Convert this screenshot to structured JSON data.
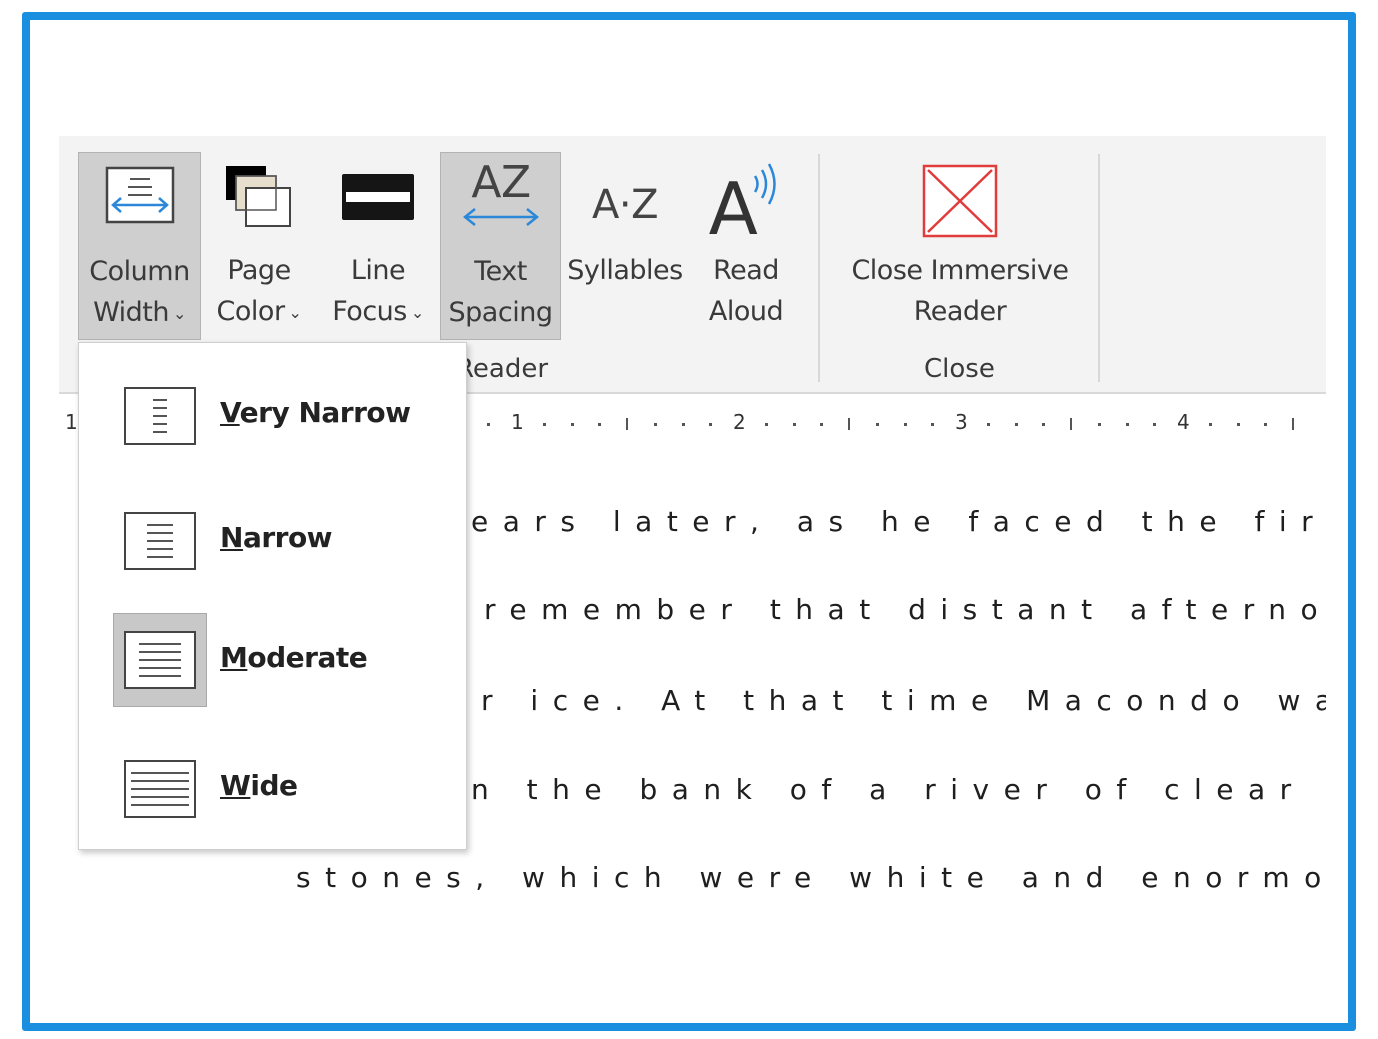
{
  "ribbon": {
    "buttons": [
      {
        "id": "column-width",
        "line1": "Column",
        "line2": "Width",
        "dropdown": true,
        "selected": true,
        "icon": "column-width-icon"
      },
      {
        "id": "page-color",
        "line1": "Page",
        "line2": "Color",
        "dropdown": true,
        "selected": false,
        "icon": "page-color-icon"
      },
      {
        "id": "line-focus",
        "line1": "Line",
        "line2": "Focus",
        "dropdown": true,
        "selected": false,
        "icon": "line-focus-icon"
      },
      {
        "id": "text-spacing",
        "line1": "Text",
        "line2": "Spacing",
        "dropdown": false,
        "selected": true,
        "icon": "text-spacing-icon",
        "icon_text": "AZ"
      },
      {
        "id": "syllables",
        "line1": "Syllables",
        "line2": "",
        "dropdown": false,
        "selected": false,
        "icon": "syllables-icon",
        "icon_text": "A·Z"
      },
      {
        "id": "read-aloud",
        "line1": "Read",
        "line2": "Aloud",
        "dropdown": false,
        "selected": false,
        "icon": "read-aloud-icon",
        "icon_text": "A"
      },
      {
        "id": "close-immersive-reader",
        "line1": "Close Immersive",
        "line2": "Reader",
        "dropdown": false,
        "selected": false,
        "icon": "close-x-icon"
      }
    ],
    "groups": {
      "reader": "Reader",
      "close": "Close"
    }
  },
  "ruler": {
    "lead": "1",
    "numbers": [
      "1",
      "2",
      "3",
      "4"
    ]
  },
  "column_width_menu": {
    "options": [
      {
        "id": "very-narrow",
        "accel": "V",
        "rest": "ery Narrow",
        "selected": false
      },
      {
        "id": "narrow",
        "accel": "N",
        "rest": "arrow",
        "selected": false
      },
      {
        "id": "moderate",
        "accel": "M",
        "rest": "oderate",
        "selected": true
      },
      {
        "id": "wide",
        "accel": "W",
        "rest": "ide",
        "selected": false
      }
    ]
  },
  "document": {
    "lines": [
      "ears later, as he faced the firing",
      "remember that distant afternoon",
      "r ice. At that time Macondo was a",
      "n the bank of a river of clear wat",
      "stones, which were white and enormous,"
    ]
  },
  "colors": {
    "frame": "#1a8fe0",
    "accent_blue": "#2b88d8",
    "close_red": "#e03c3c",
    "selected_bg": "#cfcfcf"
  }
}
